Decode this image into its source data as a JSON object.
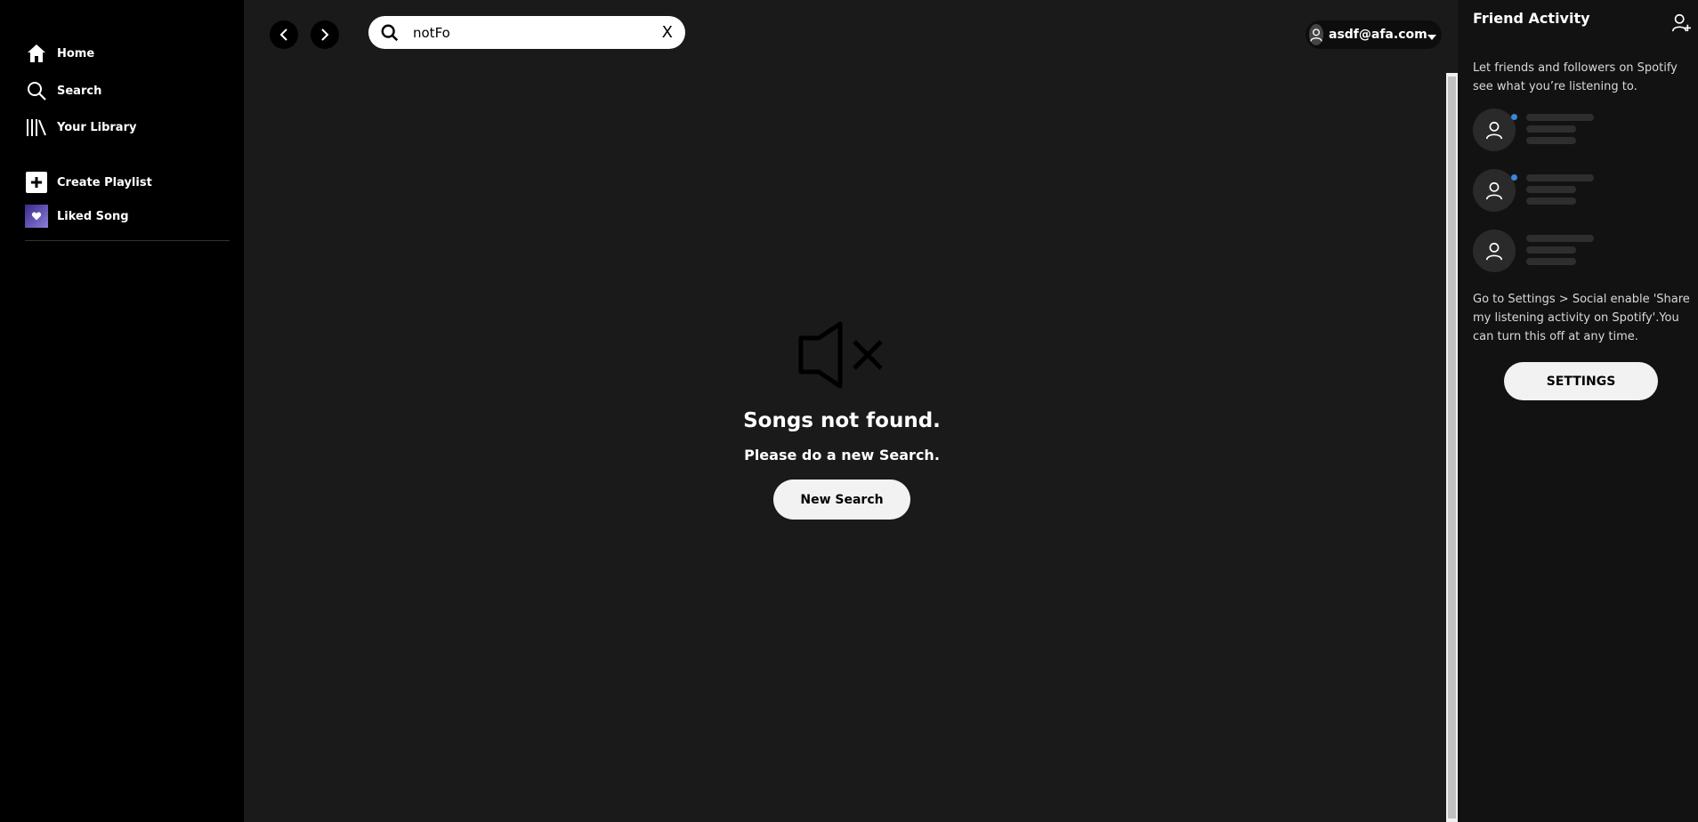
{
  "sidebar": {
    "home_label": "Home",
    "search_label": "Search",
    "library_label": "Your Library",
    "create_playlist_label": "Create Playlist",
    "liked_songs_label": "Liked Song"
  },
  "header": {
    "search_value": "notFo",
    "clear_label": "X",
    "user_email": "asdf@afa.com"
  },
  "main": {
    "empty_title": "Songs not found.",
    "empty_subtitle": "Please do a new Search.",
    "new_search_label": "New Search"
  },
  "friends": {
    "title": "Friend Activity",
    "description": "Let friends and followers on Spotify see what you’re listening to.",
    "settings_info": "Go to Settings > Social enable 'Share my listening activity on Spotify'.You can turn this off at any time.",
    "settings_label": "SETTINGS"
  },
  "colors": {
    "main_bg": "#1a1a1a",
    "sidebar_bg": "#000000",
    "panel_bg": "#121212",
    "online_dot": "#3a86d8"
  },
  "icons": [
    "home-icon",
    "search-icon",
    "library-icon",
    "plus-icon",
    "heart-icon",
    "chevron-left-icon",
    "chevron-right-icon",
    "user-icon",
    "caret-down-icon",
    "speaker-muted-icon",
    "add-friend-icon"
  ]
}
